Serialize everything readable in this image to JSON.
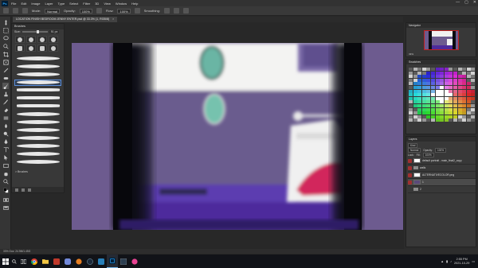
{
  "app": {
    "logo": "Ps"
  },
  "menu": [
    "File",
    "Edit",
    "Image",
    "Layer",
    "Type",
    "Select",
    "Filter",
    "3D",
    "View",
    "Window",
    "Help"
  ],
  "window_controls": [
    "—",
    "▢",
    "✕"
  ],
  "options_bar": {
    "mode_label": "Mode:",
    "mode_value": "Normal",
    "opacity_label": "Opacity:",
    "opacity_value": "100%",
    "flow_label": "Flow:",
    "flow_value": "100%",
    "smoothing_label": "Smoothing:"
  },
  "document_tab": {
    "title": "LOCATION FINISH BEDROOM JENNY ENTER.psd @ 33.3% (1, RGB/8)",
    "close": "×"
  },
  "brushes_panel": {
    "title": "Brushes",
    "size_label": "Size:",
    "size_value": "51 px",
    "folder_label": "> Brushes"
  },
  "navigator": {
    "title": "Navigator",
    "zoom": "33%"
  },
  "swatches": {
    "title": "Swatches"
  },
  "layers_panel": {
    "title": "Layers",
    "kind_label": "Kind",
    "blend_mode": "Normal",
    "opacity_label": "Opacity:",
    "opacity_value": "100%",
    "lock_label": "Lock:",
    "fill_label": "Fill:",
    "fill_value": "100%",
    "layers": [
      {
        "name": "default portrait - main_final2_copy",
        "kind": "image"
      },
      {
        "name": "walls",
        "kind": "folder"
      },
      {
        "name": "ALTERNATIVECOLOR.png",
        "kind": "image"
      },
      {
        "name": "1",
        "kind": "image"
      },
      {
        "name": "2",
        "kind": "folder"
      }
    ]
  },
  "status_bar": {
    "text": "33%    Doc: 24.9M/1.45G"
  },
  "taskbar": {
    "time": "2:55 PM",
    "date": "2021-10-29"
  },
  "colors": {
    "wall_purple": "#6b5a90",
    "bed_purple": "#5a2fa8",
    "pillow_pink": "#d2285c",
    "headboard_white": "#f0f0f0",
    "mirror_teal": "#6ab5a4",
    "selection_blue": "#5b8fdc"
  }
}
